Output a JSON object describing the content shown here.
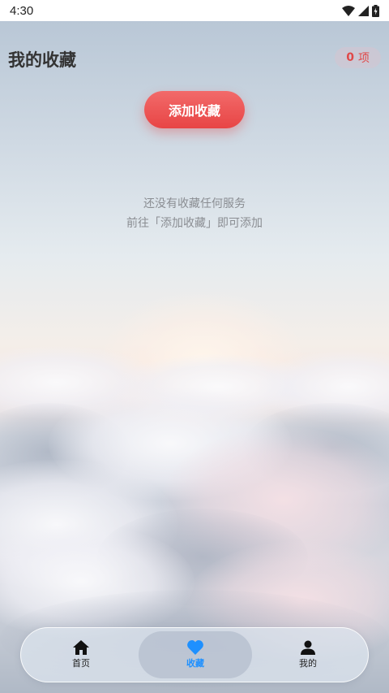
{
  "status_bar": {
    "time": "4:30",
    "icons": [
      "wifi-icon",
      "cellular-signal-icon",
      "battery-charging-icon"
    ]
  },
  "header": {
    "title": "我的收藏",
    "count_value": "0",
    "count_unit": "项"
  },
  "add_button": {
    "label": "添加收藏"
  },
  "empty_state": {
    "line1": "还没有收藏任何服务",
    "line2": "前往「添加收藏」即可添加"
  },
  "tabbar": {
    "tabs": [
      {
        "label": "首页",
        "icon": "home-icon",
        "active": false
      },
      {
        "label": "收藏",
        "icon": "heart-icon",
        "active": true
      },
      {
        "label": "我的",
        "icon": "person-icon",
        "active": false
      }
    ]
  },
  "colors": {
    "accent": "#1e90ff",
    "button": "#e84545",
    "badge_text": "#e04848"
  }
}
